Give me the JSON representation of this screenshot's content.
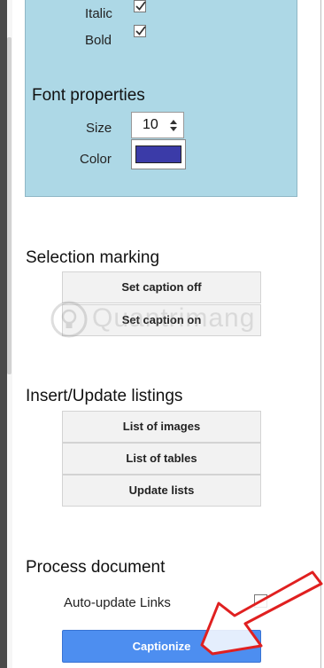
{
  "font_panel": {
    "italic_label": "Italic",
    "bold_label": "Bold",
    "italic_checked": true,
    "bold_checked": true,
    "title": "Font properties",
    "size_label": "Size",
    "size_value": "10",
    "color_label": "Color",
    "color_value": "#3b3ba8"
  },
  "selection_marking": {
    "title": "Selection marking",
    "buttons": [
      "Set caption off",
      "Set caption on"
    ]
  },
  "listings": {
    "title": "Insert/Update listings",
    "buttons": [
      "List of images",
      "List of tables",
      "Update lists"
    ]
  },
  "process": {
    "title": "Process document",
    "auto_update_label": "Auto-update Links",
    "auto_update_checked": false,
    "captionize_label": "Captionize"
  },
  "watermark": {
    "text": "Quantrimang"
  },
  "colors": {
    "panel_bg": "#add8e6",
    "primary_button": "#4d8ef0",
    "annotation_arrow": "#e02020"
  }
}
